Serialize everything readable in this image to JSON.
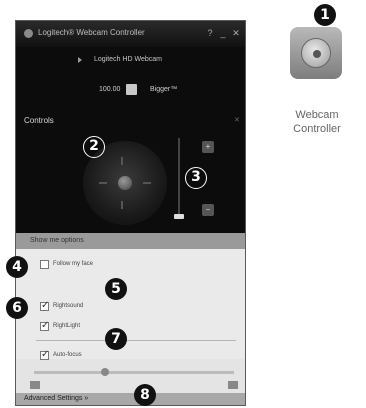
{
  "window": {
    "title": "Logitech® Webcam Controller",
    "help_label": "?",
    "minimize_label": "_",
    "close_label": "✕"
  },
  "camera": {
    "name": "Logitech HD Webcam"
  },
  "toolbar": {
    "zoom_value": "100.00",
    "mode_label": "Bigger™"
  },
  "controls": {
    "title": "Controls",
    "zoom_in_label": "+",
    "zoom_out_label": "−"
  },
  "settings": {
    "header": "Show me options",
    "options": [
      {
        "label": "Follow my face",
        "checked": false
      },
      {
        "label": "Rightsound",
        "checked": true
      },
      {
        "label": "RightLight",
        "checked": true
      },
      {
        "label": "Auto-focus",
        "checked": true
      }
    ],
    "advanced_label": "Advanced Settings »"
  },
  "launcher": {
    "label": "Webcam Controller"
  },
  "callouts": [
    "1",
    "2",
    "3",
    "4",
    "5",
    "6",
    "7",
    "8"
  ]
}
